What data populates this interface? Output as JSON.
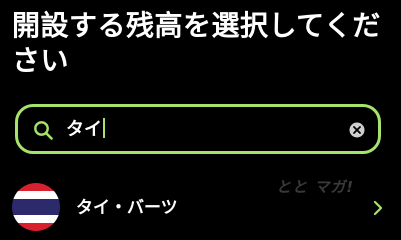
{
  "header": {
    "title": "開設する残高を選択してください"
  },
  "search": {
    "value": "タイ",
    "clear_icon": "clear-circle-icon",
    "search_icon": "search-icon",
    "accent_color": "#a7e36b"
  },
  "results": [
    {
      "label": "タイ・バーツ",
      "flag_icon": "thailand-flag-icon",
      "chevron_icon": "chevron-right-icon"
    }
  ],
  "watermark": "とと マガ!"
}
